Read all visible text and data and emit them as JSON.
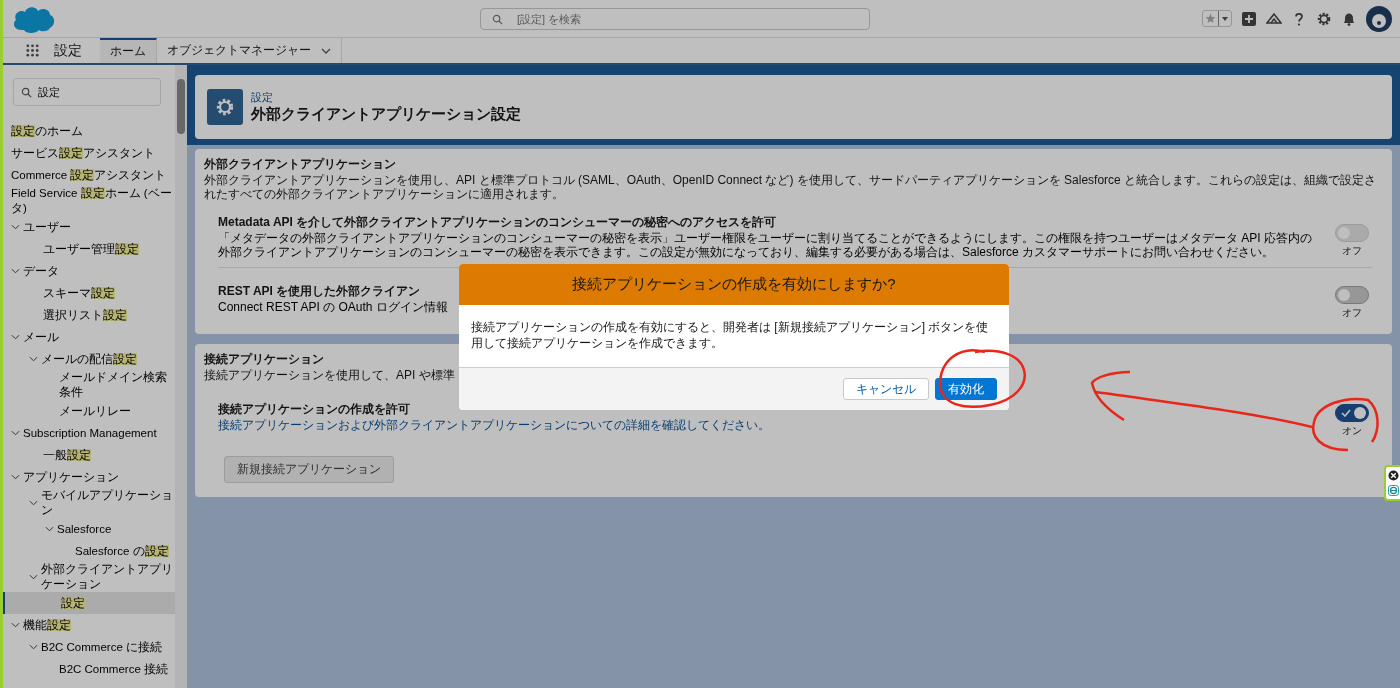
{
  "header": {
    "search_placeholder": "[設定] を検索"
  },
  "nav": {
    "app_name": "設定",
    "tabs": [
      {
        "label": "ホーム",
        "selected": true,
        "dropdown": false
      },
      {
        "label": "オブジェクトマネージャー",
        "selected": false,
        "dropdown": true
      }
    ]
  },
  "sidebar": {
    "search_value": "設定",
    "items": [
      {
        "segments": [
          {
            "text": "設定",
            "highlight": true
          },
          {
            "text": "のホーム",
            "highlight": false
          }
        ],
        "selected": false
      },
      {
        "segments": [
          {
            "text": "サービス",
            "highlight": false
          },
          {
            "text": "設定",
            "highlight": true
          },
          {
            "text": "アシスタント",
            "highlight": false
          }
        ],
        "selected": false
      },
      {
        "segments": [
          {
            "text": "Commerce ",
            "highlight": false
          },
          {
            "text": "設定",
            "highlight": true
          },
          {
            "text": "アシスタント",
            "highlight": false
          }
        ],
        "selected": false
      },
      {
        "segments": [
          {
            "text": "Field Service ",
            "highlight": false
          },
          {
            "text": "設定",
            "highlight": true
          },
          {
            "text": "ホーム (ベータ)",
            "highlight": false
          }
        ],
        "selected": false
      },
      {
        "segments": [
          {
            "text": "ユーザー",
            "highlight": false
          }
        ],
        "selected": false,
        "expanded": true,
        "children": [
          {
            "segments": [
              {
                "text": "ユーザー管理",
                "highlight": false
              },
              {
                "text": "設定",
                "highlight": true
              }
            ],
            "selected": false
          }
        ]
      },
      {
        "segments": [
          {
            "text": "データ",
            "highlight": false
          }
        ],
        "selected": false,
        "expanded": true,
        "children": [
          {
            "segments": [
              {
                "text": "スキーマ",
                "highlight": false
              },
              {
                "text": "設定",
                "highlight": true
              }
            ],
            "selected": false
          },
          {
            "segments": [
              {
                "text": "選択リスト",
                "highlight": false
              },
              {
                "text": "設定",
                "highlight": true
              }
            ],
            "selected": false
          }
        ]
      },
      {
        "segments": [
          {
            "text": "メール",
            "highlight": false
          }
        ],
        "selected": false,
        "expanded": true,
        "children": [
          {
            "segments": [
              {
                "text": "メールの配信",
                "highlight": false
              },
              {
                "text": "設定",
                "highlight": true
              }
            ],
            "selected": false,
            "expanded": true,
            "children": [
              {
                "segments": [
                  {
                    "text": "メールドメイン検索条件",
                    "highlight": false
                  }
                ],
                "selected": false
              },
              {
                "segments": [
                  {
                    "text": "メールリレー",
                    "highlight": false
                  }
                ],
                "selected": false
              }
            ]
          }
        ]
      },
      {
        "segments": [
          {
            "text": "Subscription Management",
            "highlight": false
          }
        ],
        "selected": false,
        "expanded": true,
        "children": [
          {
            "segments": [
              {
                "text": "一般",
                "highlight": false
              },
              {
                "text": "設定",
                "highlight": true
              }
            ],
            "selected": false
          }
        ]
      },
      {
        "segments": [
          {
            "text": "アプリケーション",
            "highlight": false
          }
        ],
        "selected": false,
        "expanded": true,
        "children": [
          {
            "segments": [
              {
                "text": "モバイルアプリケーション",
                "highlight": false
              }
            ],
            "selected": false,
            "expanded": true,
            "children": [
              {
                "segments": [
                  {
                    "text": "Salesforce",
                    "highlight": false
                  }
                ],
                "selected": false,
                "expanded": true,
                "children": [
                  {
                    "segments": [
                      {
                        "text": "Salesforce の",
                        "highlight": false
                      },
                      {
                        "text": "設定",
                        "highlight": true
                      }
                    ],
                    "selected": false
                  }
                ]
              }
            ]
          },
          {
            "segments": [
              {
                "text": "外部クライアントアプリケーション",
                "highlight": false
              }
            ],
            "selected": false,
            "expanded": true,
            "children": [
              {
                "segments": [
                  {
                    "text": "設定",
                    "highlight": true
                  }
                ],
                "selected": true
              }
            ]
          }
        ]
      },
      {
        "segments": [
          {
            "text": "機能",
            "highlight": false
          },
          {
            "text": "設定",
            "highlight": true
          }
        ],
        "selected": false,
        "expanded": true,
        "children": [
          {
            "segments": [
              {
                "text": "B2C Commerce に接続",
                "highlight": false
              }
            ],
            "selected": false,
            "expanded": true,
            "children": [
              {
                "segments": [
                  {
                    "text": "B2C Commerce 接続",
                    "highlight": false
                  }
                ],
                "selected": false
              }
            ]
          }
        ]
      }
    ]
  },
  "page_header": {
    "breadcrumb": "設定",
    "title": "外部クライアントアプリケーション設定"
  },
  "sections": [
    {
      "title": "外部クライアントアプリケーション",
      "description": "外部クライアントアプリケーションを使用し、API と標準プロトコル (SAML、OAuth、OpenID Connect など) を使用して、サードパーティアプリケーションを Salesforce と統合します。これらの設定は、組織で設定されたすべての外部クライアントアプリケーションに適用されます。",
      "settings": [
        {
          "title": "Metadata API を介して外部クライアントアプリケーションのコンシューマーの秘密へのアクセスを許可",
          "description": "「メタデータの外部クライアントアプリケーションのコンシューマーの秘密を表示」ユーザー権限をユーザーに割り当てることができるようにします。この権限を持つユーザーはメタデータ API 応答内の外部クライアントアプリケーションのコンシューマーの秘密を表示できます。この設定が無効になっており、編集する必要がある場合は、Salesforce カスタマーサポートにお問い合わせください。",
          "link": false,
          "on": false,
          "disabled": true,
          "toggle_label": "オフ"
        },
        {
          "title": "REST API を使用した外部クライアン",
          "description": "Connect REST API の OAuth ログイン情報",
          "link": false,
          "on": false,
          "disabled": false,
          "toggle_label": "オフ"
        }
      ]
    },
    {
      "title": "接続アプリケーション",
      "description": "接続アプリケーションを使用して、API や標準",
      "settings": [
        {
          "title": "接続アプリケーションの作成を許可",
          "description": "接続アプリケーションおよび外部クライアントアプリケーションについての詳細を確認してください。",
          "link": true,
          "on": true,
          "disabled": false,
          "toggle_label": "オン"
        }
      ],
      "button": {
        "label": "新規接続アプリケーション",
        "disabled": true
      }
    }
  ],
  "modal": {
    "title": "接続アプリケーションの作成を有効にしますか?",
    "body": "接続アプリケーションの作成を有効にすると、開発者は [新規接続アプリケーション] ボタンを使用して接続アプリケーションを作成できます。",
    "buttons": [
      {
        "label": "キャンセル",
        "kind": "neutral"
      },
      {
        "label": "有効化",
        "kind": "brand"
      }
    ]
  }
}
